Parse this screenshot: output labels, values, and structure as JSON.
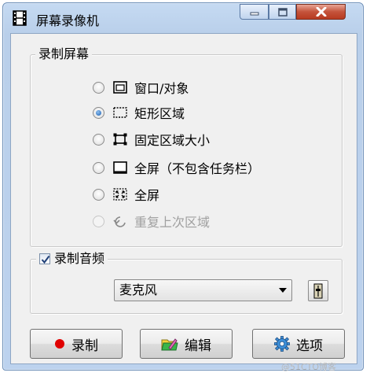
{
  "window": {
    "title": "屏幕录像机"
  },
  "recording_group": {
    "label": "录制屏幕",
    "options": [
      {
        "label": "窗口/对象",
        "icon": "window-object-icon",
        "selected": false,
        "enabled": true
      },
      {
        "label": "矩形区域",
        "icon": "rectangle-region-icon",
        "selected": true,
        "enabled": true
      },
      {
        "label": "固定区域大小",
        "icon": "fixed-region-icon",
        "selected": false,
        "enabled": true
      },
      {
        "label": "全屏（不包含任务栏）",
        "icon": "fullscreen-no-taskbar-icon",
        "selected": false,
        "enabled": true
      },
      {
        "label": "全屏",
        "icon": "fullscreen-icon",
        "selected": false,
        "enabled": true
      },
      {
        "label": "重复上次区域",
        "icon": "repeat-last-region-icon",
        "selected": false,
        "enabled": false
      }
    ]
  },
  "audio_group": {
    "label": "录制音频",
    "checked": true,
    "device_selected": "麦克风"
  },
  "buttons": {
    "record": "录制",
    "edit": "编辑",
    "options": "选项"
  },
  "watermark": "@51CTO博客",
  "colors": {
    "title_bar": "#c5daf2",
    "close_button": "#c4533b",
    "record_dot": "#e00000",
    "selected_radio": "#1b5fb0"
  }
}
